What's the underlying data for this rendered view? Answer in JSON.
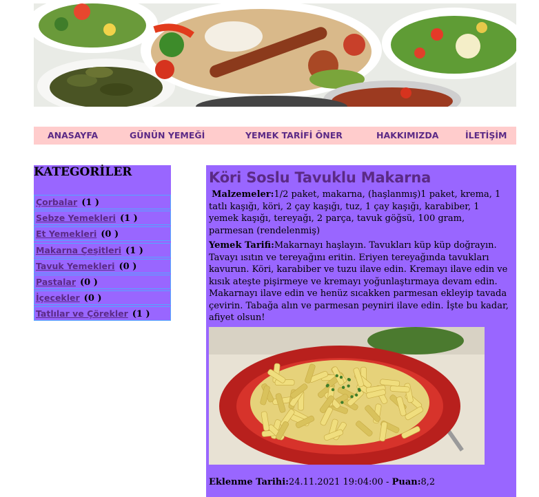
{
  "nav": {
    "items": [
      "ANASAYFA",
      "GÜNÜN YEMEĞİ",
      "YEMEK TARİFİ ÖNER",
      "HAKKIMIZDA",
      "İLETİŞİM"
    ]
  },
  "sidebar": {
    "title": "KATEGORİLER",
    "categories": [
      {
        "name": "Çorbalar",
        "count": "(1 )"
      },
      {
        "name": "Sebze Yemekleri",
        "count": "(1 )"
      },
      {
        "name": "Et Yemekleri",
        "count": "(0 )"
      },
      {
        "name": "Makarna Çeşitleri",
        "count": "(1 )"
      },
      {
        "name": "Tavuk Yemekleri",
        "count": "(0 )"
      },
      {
        "name": "Pastalar",
        "count": "(0 )"
      },
      {
        "name": "İçecekler",
        "count": "(0 )"
      },
      {
        "name": "Tatlılar ve Çörekler",
        "count": "(1 )"
      }
    ]
  },
  "recipe": {
    "title": "Köri Soslu Tavuklu Makarna",
    "ingredients_label": "Malzemeler:",
    "ingredients_text": "1/2 paket, makarna, (haşlanmış)1 paket, krema, 1 tatlı kaşığı, köri, 2 çay kaşığı, tuz, 1 çay kaşığı, karabiber, 1 yemek kaşığı, tereyağı, 2 parça, tavuk göğsü, 100 gram, parmesan (rendelenmiş)",
    "method_label": "Yemek Tarifi:",
    "method_text": "Makarnayı haşlayın. Tavukları küp küp doğrayın. Tavayı ısıtın ve tereyağını eritin. Eriyen tereyağında tavukları kavurun. Köri, karabiber ve tuzu ilave edin. Kremayı ilave edin ve kısık ateşte pişirmeye ve kremayı yoğunlaştırmaya devam edin. Makarnayı ilave edin ve henüz sıcakken parmesan ekleyip tavada çevirin. Tabağa alın ve parmesan peyniri ilave edin. İşte bu kadar, afiyet olsun!",
    "date_label": "Eklenme Tarihi:",
    "date_value": "24.11.2021 19:04:00",
    "separator": " - ",
    "rating_label": "Puan:",
    "rating_value": "8,2"
  }
}
